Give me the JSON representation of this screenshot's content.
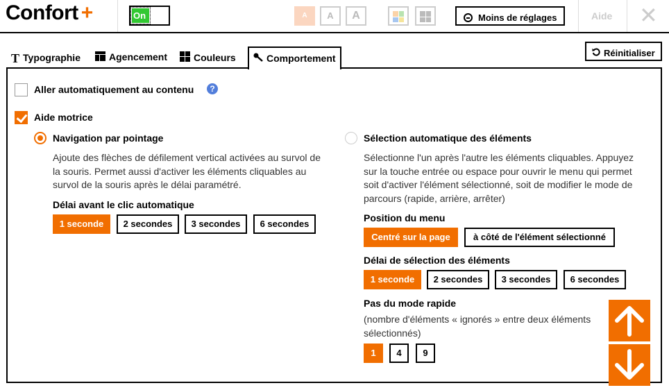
{
  "header": {
    "logo_text": "Confort",
    "logo_plus": "+",
    "toggle_label": "On",
    "text_size_labels": [
      "A",
      "A",
      "A"
    ],
    "less_settings_label": "Moins de réglages",
    "help_label": "Aide",
    "close_glyph": "✕"
  },
  "tabs": [
    {
      "label": "Typographie",
      "icon": "T"
    },
    {
      "label": "Agencement"
    },
    {
      "label": "Couleurs"
    },
    {
      "label": "Comportement"
    }
  ],
  "reset_label": "Réinitialiser",
  "options": {
    "auto_content": {
      "label": "Aller automatiquement au contenu",
      "checked": false,
      "help": "?"
    },
    "motor_aid": {
      "label": "Aide motrice",
      "checked": true
    }
  },
  "left": {
    "radio_label": "Navigation par pointage",
    "selected": true,
    "description": "Ajoute des flèches de défilement vertical activées au survol de la souris. Permet aussi d'activer les éléments cliquables au survol de la souris après le délai paramétré.",
    "delay_label": "Délai avant le clic automatique",
    "delay_options": [
      "1 seconde",
      "2 secondes",
      "3 secondes",
      "6 secondes"
    ],
    "delay_selected": "1 seconde"
  },
  "right": {
    "radio_label": "Sélection automatique des éléments",
    "selected": false,
    "description": "Sélectionne l'un après l'autre les éléments cliquables. Appuyez sur la touche entrée ou espace pour ouvrir le menu qui permet soit d'activer l'élément sélectionné, soit de modifier le mode de parcours (rapide, arrière, arrêter)",
    "menu_position_label": "Position du menu",
    "menu_position_options": [
      "Centré sur la page",
      "à côté de l'élément sélectionné"
    ],
    "menu_position_selected": "Centré sur la page",
    "selection_delay_label": "Délai de sélection des éléments",
    "selection_delay_options": [
      "1 seconde",
      "2 secondes",
      "3 secondes",
      "6 secondes"
    ],
    "selection_delay_selected": "1 seconde",
    "fast_step_label": "Pas du mode rapide",
    "fast_step_desc": "(nombre d'éléments « ignorés » entre deux éléments sélectionnés)",
    "fast_step_options": [
      "1",
      "4",
      "9"
    ],
    "fast_step_selected": "1"
  },
  "colors": {
    "accent": "#f16e00",
    "toggle_on": "#32c832",
    "help": "#527edb"
  }
}
